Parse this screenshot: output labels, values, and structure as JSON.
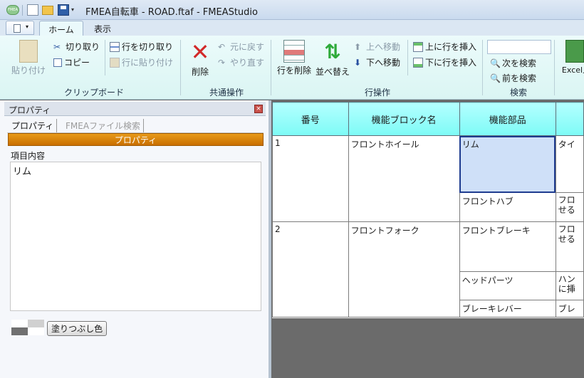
{
  "window": {
    "title": "FMEA自転車 - ROAD.ftaf - FMEAStudio",
    "app_icon_text": "FMEA"
  },
  "tabs": [
    {
      "label": "ホーム"
    },
    {
      "label": "表示"
    }
  ],
  "ribbon": {
    "clipboard": {
      "label": "クリップボード",
      "paste": "貼り付け",
      "cut": "切り取り",
      "copy": "コピー",
      "cut_row": "行を切り取り",
      "paste_row": "行に貼り付け"
    },
    "common": {
      "label": "共通操作",
      "delete": "削除",
      "undo": "元に戻す",
      "redo": "やり直す"
    },
    "row_ops": {
      "label": "行操作",
      "delete_row": "行を削除",
      "sort": "並べ替え",
      "move_up": "上へ移動",
      "move_down": "下へ移動",
      "insert_above": "上に行を挿入",
      "insert_below": "下に行を挿入"
    },
    "search": {
      "label": "検索",
      "find_next": "次を検索",
      "find_prev": "前を検索",
      "value": ""
    },
    "excel": {
      "label": "Excel入"
    }
  },
  "panel": {
    "title": "プロパティ",
    "close_icon": "×",
    "tab_properties": "プロパティ",
    "tab_fmea_search": "FMEAファイル検索",
    "section_header": "プロパティ",
    "item_label": "項目内容",
    "item_value": "リム",
    "fill_button": "塗りつぶし色"
  },
  "grid": {
    "headers": [
      "番号",
      "機能ブロック名",
      "機能部品",
      ""
    ],
    "rows": [
      {
        "num": "1",
        "block": "フロントホイール",
        "part": "リム",
        "extra": "タイ"
      },
      {
        "part": "フロントハブ",
        "extra": "フロ\nせる"
      },
      {
        "num": "2",
        "block": "フロントフォーク",
        "part": "フロントブレーキ",
        "extra": "フロ\nせる"
      },
      {
        "part": "ヘッドパーツ",
        "extra": "ハン\nに挿"
      },
      {
        "part": "ブレーキレバー",
        "extra": "ブレ"
      }
    ]
  },
  "colors": {
    "accent_orange": "#d47d00",
    "header_cyan": "#8ffcf8",
    "selection": "#cfe0f8"
  }
}
